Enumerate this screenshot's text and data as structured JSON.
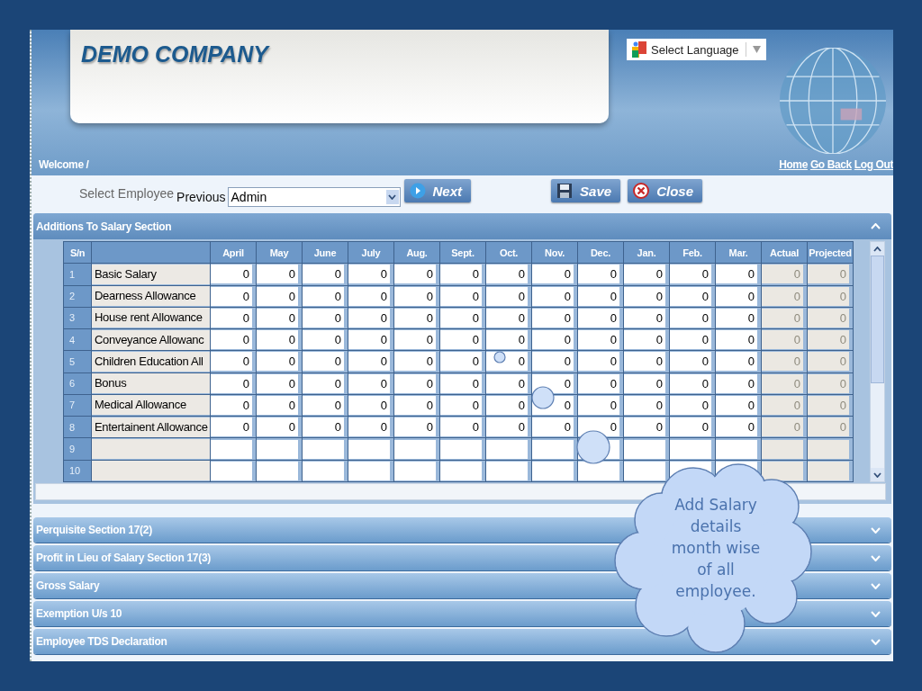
{
  "header": {
    "company": "DEMO COMPANY",
    "language": "Select Language",
    "welcome": "Welcome /",
    "links": [
      "Home",
      "Go Back",
      "Log Out"
    ]
  },
  "toolbar": {
    "label": "Select Employee",
    "previous": "Previous",
    "employee": "Admin",
    "buttons": [
      {
        "kind": "next",
        "label": "Next"
      },
      {
        "kind": "save",
        "label": "Save"
      },
      {
        "kind": "close",
        "label": "Close"
      }
    ]
  },
  "section": {
    "title": "Additions To Salary Section",
    "expanded": true,
    "table": {
      "sn_heading": "S/n",
      "months": [
        "April",
        "May",
        "June",
        "July",
        "Aug.",
        "Sept.",
        "Oct.",
        "Nov.",
        "Dec.",
        "Jan.",
        "Feb.",
        "Mar."
      ],
      "totals": [
        "Actual",
        "Projected"
      ],
      "totals_disabled": true,
      "rows": [
        {
          "sn": "1",
          "name": "Basic Salary",
          "values": [
            "0",
            "0",
            "0",
            "0",
            "0",
            "0",
            "0",
            "0",
            "0",
            "0",
            "0",
            "0"
          ],
          "totals": [
            "0",
            "0"
          ]
        },
        {
          "sn": "2",
          "name": "Dearness Allowance",
          "values": [
            "0",
            "0",
            "0",
            "0",
            "0",
            "0",
            "0",
            "0",
            "0",
            "0",
            "0",
            "0"
          ],
          "totals": [
            "0",
            "0"
          ]
        },
        {
          "sn": "3",
          "name": "House rent Allowance",
          "values": [
            "0",
            "0",
            "0",
            "0",
            "0",
            "0",
            "0",
            "0",
            "0",
            "0",
            "0",
            "0"
          ],
          "totals": [
            "0",
            "0"
          ]
        },
        {
          "sn": "4",
          "name": "Conveyance Allowanc",
          "values": [
            "0",
            "0",
            "0",
            "0",
            "0",
            "0",
            "0",
            "0",
            "0",
            "0",
            "0",
            "0"
          ],
          "totals": [
            "0",
            "0"
          ]
        },
        {
          "sn": "5",
          "name": "Children Education All",
          "values": [
            "0",
            "0",
            "0",
            "0",
            "0",
            "0",
            "0",
            "0",
            "0",
            "0",
            "0",
            "0"
          ],
          "totals": [
            "0",
            "0"
          ]
        },
        {
          "sn": "6",
          "name": "Bonus",
          "values": [
            "0",
            "0",
            "0",
            "0",
            "0",
            "0",
            "0",
            "0",
            "0",
            "0",
            "0",
            "0"
          ],
          "totals": [
            "0",
            "0"
          ]
        },
        {
          "sn": "7",
          "name": "Medical Allowance",
          "values": [
            "0",
            "0",
            "0",
            "0",
            "0",
            "0",
            "0",
            "0",
            "0",
            "0",
            "0",
            "0"
          ],
          "totals": [
            "0",
            "0"
          ]
        },
        {
          "sn": "8",
          "name": "Entertainent Allowance",
          "values": [
            "0",
            "0",
            "0",
            "0",
            "0",
            "0",
            "0",
            "0",
            "0",
            "0",
            "0",
            "0"
          ],
          "totals": [
            "0",
            "0"
          ]
        },
        {
          "sn": "9"
        },
        {
          "sn": "10"
        }
      ]
    }
  },
  "sections": [
    {
      "title": "Perquisite Section 17(2)",
      "expanded": false
    },
    {
      "title": "Profit in Lieu of Salary Section 17(3)",
      "expanded": false
    },
    {
      "title": "Gross Salary",
      "expanded": false
    },
    {
      "title": "Exemption U/s 10",
      "expanded": false
    },
    {
      "title": "Employee TDS Declaration",
      "expanded": false
    }
  ],
  "callout": {
    "text": "Add Salary details month wise of all employee."
  }
}
